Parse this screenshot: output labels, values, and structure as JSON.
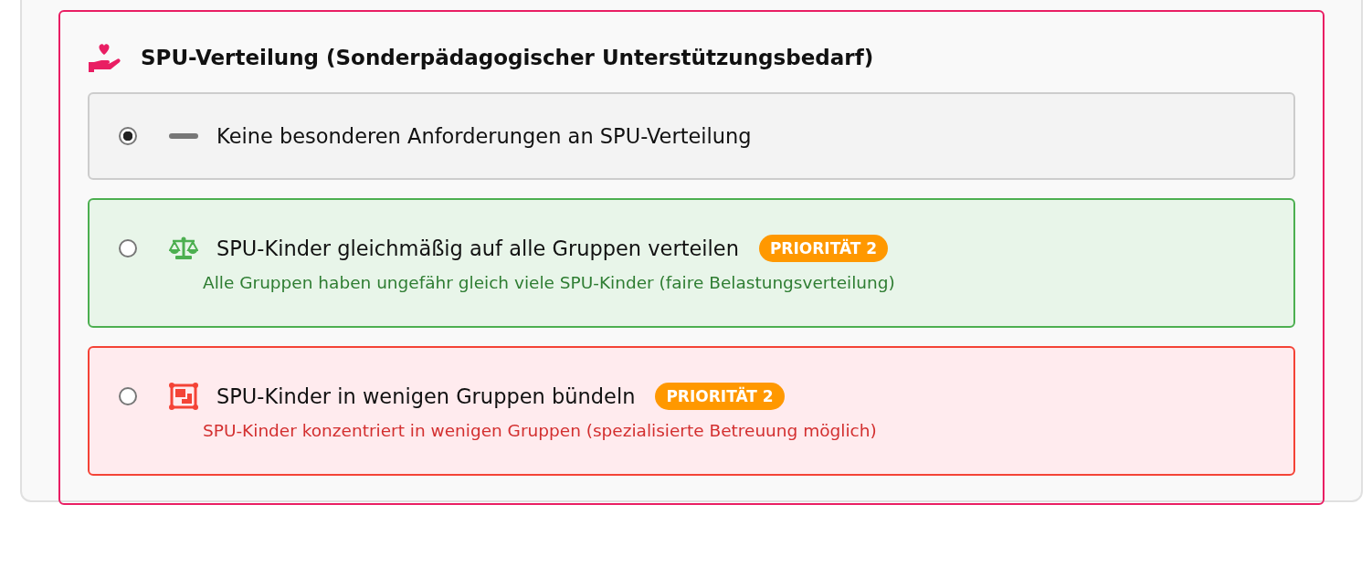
{
  "section": {
    "title": "SPU-Verteilung (Sonderpädagogischer Unterstützungsbedarf)"
  },
  "options": [
    {
      "kind": "none",
      "selected": true,
      "label": "Keine besonderen Anforderungen an SPU-Verteilung"
    },
    {
      "kind": "equal",
      "selected": false,
      "label": "SPU-Kinder gleichmäßig auf alle Gruppen verteilen",
      "badge": "PRIORITÄT 2",
      "description": "Alle Gruppen haben ungefähr gleich viele SPU-Kinder (faire Belastungsverteilung)"
    },
    {
      "kind": "cluster",
      "selected": false,
      "label": "SPU-Kinder in wenigen Gruppen bündeln",
      "badge": "PRIORITÄT 2",
      "description": "SPU-Kinder konzentriert in wenigen Gruppen (spezialisierte Betreuung möglich)"
    }
  ]
}
